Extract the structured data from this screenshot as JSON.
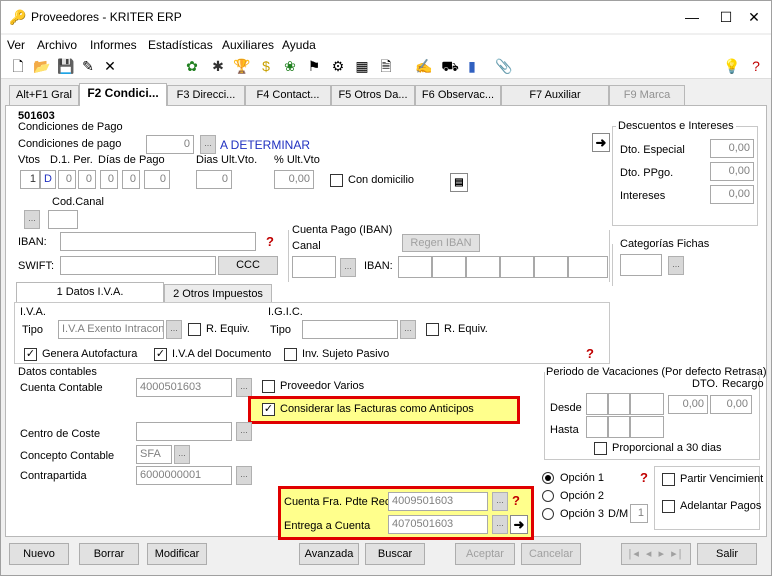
{
  "window": {
    "title": "Proveedores - KRITER ERP",
    "minimize": "—",
    "maximize": "☐",
    "close": "✕"
  },
  "menu": [
    "Ver",
    "Archivo",
    "Informes",
    "Estadísticas",
    "Auxiliares",
    "Ayuda"
  ],
  "tabs": [
    {
      "label": "Alt+F1 Gral"
    },
    {
      "label": "F2 Condici..."
    },
    {
      "label": "F3 Direcci..."
    },
    {
      "label": "F4 Contact..."
    },
    {
      "label": "F5 Otros Da..."
    },
    {
      "label": "F6 Observac..."
    },
    {
      "label": "F7 Auxiliar"
    },
    {
      "label": "F9 Marca"
    }
  ],
  "record_code": "501603",
  "pago": {
    "group_title": "Condiciones de Pago",
    "cond_label": "Condiciones de pago",
    "cond_value": "0",
    "cond_text": "A DETERMINAR",
    "vtos_label": "Vtos",
    "dper_label": "D.1. Per.",
    "dias_label": "Días de Pago",
    "dias_ult_label": "Dias Ult.Vto.",
    "pct_ult_label": "% Ult.Vto",
    "vtos_value": "1",
    "dper_value": "D",
    "dias_values": [
      "0",
      "0",
      "0",
      "0",
      "0"
    ],
    "dias_ult_value": "0",
    "pct_ult_value": "0,00",
    "con_domicilio": "Con domicilio",
    "codcanal_label": "Cod.Canal",
    "iban_label": "IBAN:",
    "swift_label": "SWIFT:",
    "ccc_label": "CCC",
    "cuenta_pago_title": "Cuenta Pago (IBAN)",
    "canal_label": "Canal",
    "regen_label": "Regen IBAN",
    "iban2_label": "IBAN:"
  },
  "descuentos": {
    "title": "Descuentos e Intereses",
    "items": [
      {
        "label": "Dto. Especial",
        "value": "0,00"
      },
      {
        "label": "Dto. PPgo.",
        "value": "0,00"
      },
      {
        "label": "Intereses",
        "value": "0,00"
      }
    ]
  },
  "categorias_title": "Categorías Fichas",
  "subtabs": [
    "1 Datos I.V.A.",
    "2 Otros Impuestos"
  ],
  "iva": {
    "title": "I.V.A.",
    "tipo_label": "Tipo",
    "tipo_value": "I.V.A Exento Intracon",
    "requiv": "R. Equiv."
  },
  "igic": {
    "title": "I.G.I.C.",
    "tipo_label": "Tipo",
    "tipo_value": "",
    "requiv": "R. Equiv."
  },
  "checks_row": {
    "genera": "Genera Autofactura",
    "iva_doc": "I.V.A del Documento",
    "inv": "Inv. Sujeto Pasivo"
  },
  "contables": {
    "title": "Datos contables",
    "cuenta_label": "Cuenta Contable",
    "cuenta_value": "4000501603",
    "proveedor_varios": "Proveedor Varios",
    "considerar": "Considerar las Facturas como Anticipos",
    "centro_label": "Centro de Coste",
    "concepto_label": "Concepto Contable",
    "concepto_value": "SFA",
    "contrapartida_label": "Contrapartida",
    "contrapartida_value": "6000000001",
    "cuenta_fra_label": "Cuenta Fra. Pdte Rec.",
    "cuenta_fra_value": "4009501603",
    "entrega_label": "Entrega a Cuenta",
    "entrega_value": "4070501603"
  },
  "vacaciones": {
    "title": "Periodo de Vacaciones (Por defecto Retrasa)",
    "dto_label": "DTO.",
    "recargo_label": "Recargo",
    "desde_label": "Desde",
    "hasta_label": "Hasta",
    "dto_value": "0,00",
    "recargo_value": "0,00",
    "proporcional": "Proporcional a 30 dias"
  },
  "opciones": {
    "op1": "Opción 1",
    "op2": "Opción 2",
    "op3": "Opción 3",
    "dm_label": "D/M",
    "dm_value": "1",
    "partir": "Partir Vencimient",
    "adelantar": "Adelantar Pagos"
  },
  "footer": {
    "nuevo": "Nuevo",
    "borrar": "Borrar",
    "modificar": "Modificar",
    "avanzada": "Avanzada",
    "buscar": "Buscar",
    "aceptar": "Aceptar",
    "cancelar": "Cancelar",
    "salir": "Salir"
  }
}
